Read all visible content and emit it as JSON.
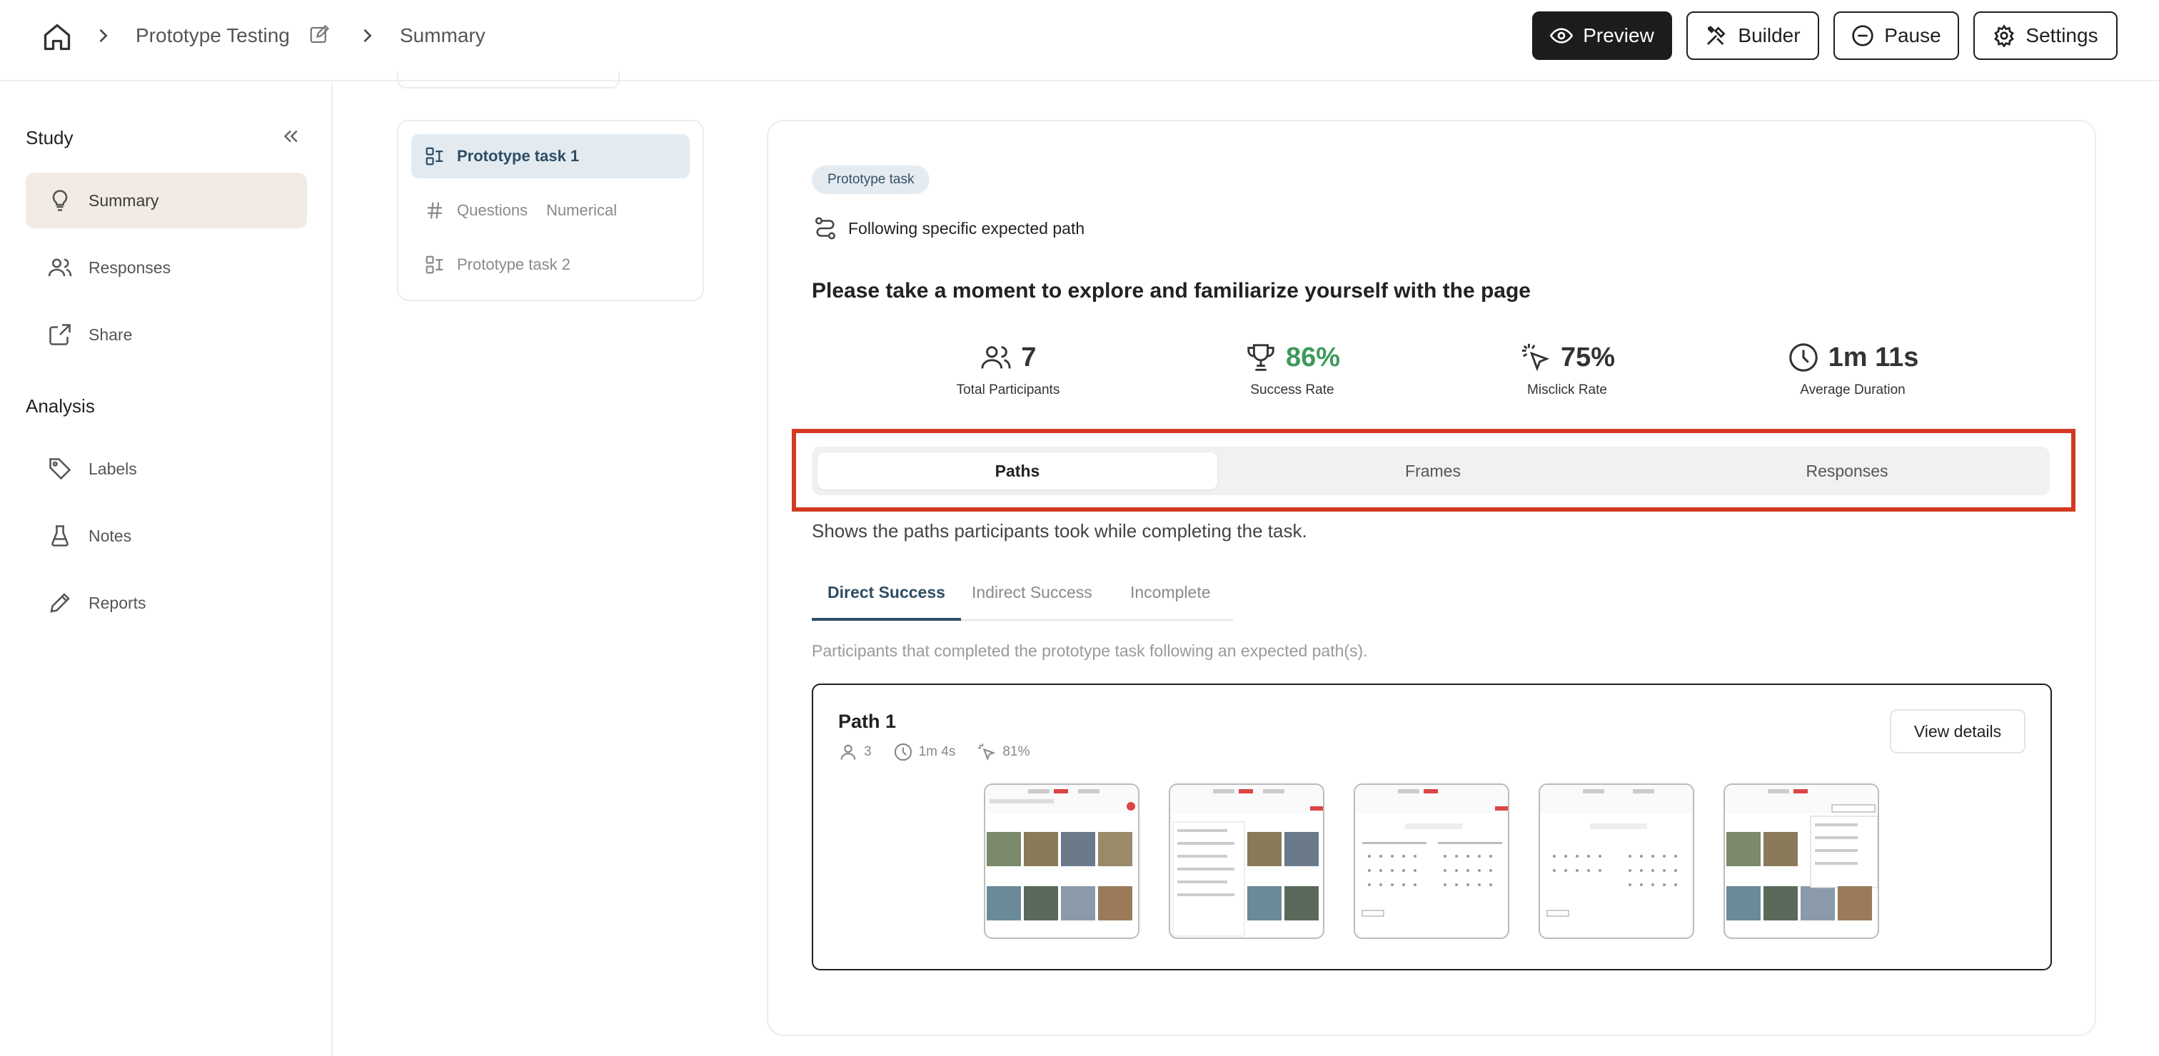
{
  "header": {
    "breadcrumb_study": "Prototype Testing",
    "breadcrumb_page": "Summary",
    "preview_label": "Preview",
    "builder_label": "Builder",
    "pause_label": "Pause",
    "settings_label": "Settings"
  },
  "sidebar": {
    "study_heading": "Study",
    "analysis_heading": "Analysis",
    "study_items": [
      {
        "label": "Summary",
        "icon": "lightbulb-icon"
      },
      {
        "label": "Responses",
        "icon": "users-icon"
      },
      {
        "label": "Share",
        "icon": "share-icon"
      }
    ],
    "analysis_items": [
      {
        "label": "Labels",
        "icon": "tag-icon"
      },
      {
        "label": "Notes",
        "icon": "flask-icon"
      },
      {
        "label": "Reports",
        "icon": "pencil-icon"
      }
    ]
  },
  "tasks": [
    {
      "label": "Prototype task 1",
      "icon": "prototype-task-icon",
      "active": true
    },
    {
      "label": "Questions",
      "tag": "Numerical",
      "icon": "hash-icon",
      "active": false
    },
    {
      "label": "Prototype task 2",
      "icon": "prototype-task-icon",
      "active": false
    }
  ],
  "task_detail": {
    "badge": "Prototype task",
    "path_type": "Following specific expected path",
    "title": "Please take a moment to explore and familiarize yourself with the page"
  },
  "stats": [
    {
      "value": "7",
      "label": "Total Participants",
      "icon": "users-icon"
    },
    {
      "value": "86%",
      "label": "Success Rate",
      "icon": "trophy-icon"
    },
    {
      "value": "75%",
      "label": "Misclick Rate",
      "icon": "cursor-click-icon"
    },
    {
      "value": "1m 11s",
      "label": "Average Duration",
      "icon": "clock-icon"
    }
  ],
  "view_tabs": [
    "Paths",
    "Frames",
    "Responses"
  ],
  "paths_description": "Shows the paths participants took while completing the task.",
  "result_tabs": [
    "Direct Success",
    "Indirect Success",
    "Incomplete"
  ],
  "result_description": "Participants that completed the prototype task following an expected path(s).",
  "path": {
    "title": "Path 1",
    "participants": "3",
    "duration": "1m 4s",
    "misclick": "81%",
    "view_details_label": "View details",
    "thumbnail_count": 5
  },
  "colors": {
    "accent_blue": "#2f4d63",
    "success_green": "#3d9a5b",
    "highlight_red": "#d23b22",
    "active_sidebar_bg": "#f1ebe3"
  }
}
